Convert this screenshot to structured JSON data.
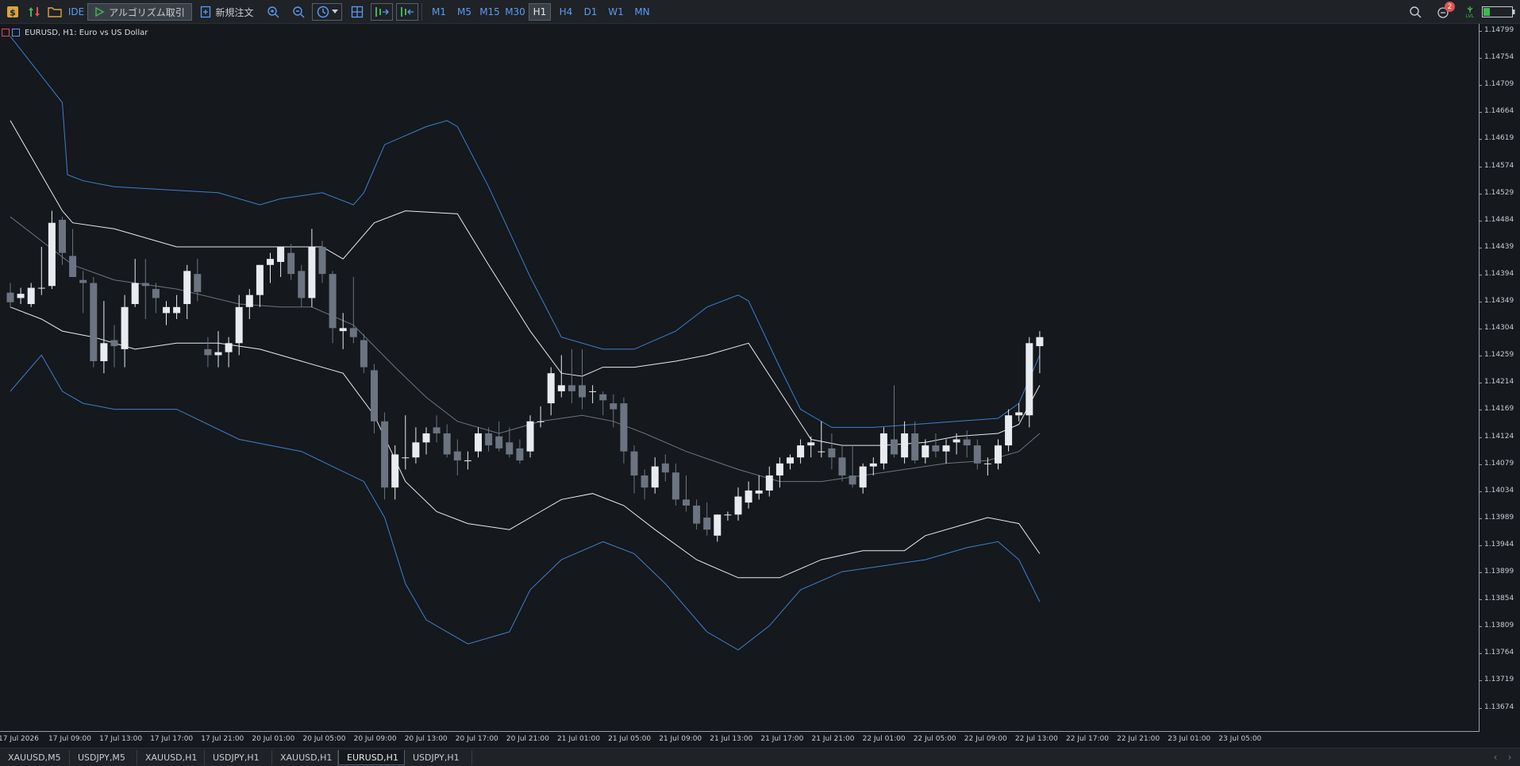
{
  "toolbar": {
    "ide_label": "IDE",
    "algo_label": "アルゴリズム取引",
    "new_order_label": "新規注文",
    "timeframes": [
      "M1",
      "M5",
      "M15",
      "M30",
      "H1",
      "H4",
      "D1",
      "W1",
      "MN"
    ],
    "active_timeframe": "H1",
    "notification_count": "2",
    "lvl_label": "LVL"
  },
  "chart": {
    "legend": "EURUSD, H1:  Euro vs US Dollar",
    "price_labels": [
      "1.14799",
      "1.14754",
      "1.14709",
      "1.14664",
      "1.14619",
      "1.14574",
      "1.14529",
      "1.14484",
      "1.14439",
      "1.14394",
      "1.14349",
      "1.14304",
      "1.14259",
      "1.14214",
      "1.14169",
      "1.14124",
      "1.14079",
      "1.14034",
      "1.13989",
      "1.13944",
      "1.13899",
      "1.13854",
      "1.13809",
      "1.13764",
      "1.13719",
      "1.13674"
    ],
    "time_labels": [
      "17 Jul 2026",
      "17 Jul 09:00",
      "17 Jul 13:00",
      "17 Jul 17:00",
      "17 Jul 21:00",
      "20 Jul 01:00",
      "20 Jul 05:00",
      "20 Jul 09:00",
      "20 Jul 13:00",
      "20 Jul 17:00",
      "20 Jul 21:00",
      "21 Jul 01:00",
      "21 Jul 05:00",
      "21 Jul 09:00",
      "21 Jul 13:00",
      "21 Jul 17:00",
      "21 Jul 21:00",
      "22 Jul 01:00",
      "22 Jul 05:00",
      "22 Jul 09:00",
      "22 Jul 13:00",
      "22 Jul 17:00",
      "22 Jul 21:00",
      "23 Jul 01:00",
      "23 Jul 05:00"
    ],
    "colors": {
      "bull": "#e8ebf0",
      "bear": "#6b7480",
      "outer_band": "#3d7fd0",
      "inner_band": "#e8ebf0",
      "mid_line": "#6e747c",
      "background": "#15181d"
    }
  },
  "tabs": [
    {
      "label": "XAUUSD,M5",
      "active": false
    },
    {
      "label": "USDJPY,M5",
      "active": false
    },
    {
      "label": "XAUUSD,H1",
      "active": false
    },
    {
      "label": "USDJPY,H1",
      "active": false
    },
    {
      "label": "XAUUSD,H1",
      "active": false
    },
    {
      "label": "EURUSD,H1",
      "active": true
    },
    {
      "label": "USDJPY,H1",
      "active": false
    }
  ],
  "chart_data": {
    "type": "candlestick",
    "symbol": "EURUSD",
    "timeframe": "H1",
    "ylim": [
      1.1365,
      1.148
    ],
    "y_range_labeled": [
      1.13674,
      1.14799
    ],
    "candles": [
      [
        1.14364,
        1.1438,
        1.1434,
        1.14348
      ],
      [
        1.14355,
        1.14372,
        1.14345,
        1.14362
      ],
      [
        1.14345,
        1.1438,
        1.1434,
        1.14372
      ],
      [
        1.14372,
        1.1444,
        1.1436,
        1.14372
      ],
      [
        1.14375,
        1.145,
        1.1437,
        1.1448
      ],
      [
        1.14485,
        1.1449,
        1.1441,
        1.1443
      ],
      [
        1.14425,
        1.1447,
        1.1439,
        1.1439
      ],
      [
        1.14385,
        1.144,
        1.1433,
        1.1438
      ],
      [
        1.1438,
        1.1439,
        1.1424,
        1.1425
      ],
      [
        1.1425,
        1.1435,
        1.1423,
        1.1428
      ],
      [
        1.14285,
        1.1431,
        1.1424,
        1.14275
      ],
      [
        1.1427,
        1.1436,
        1.1424,
        1.1434
      ],
      [
        1.14345,
        1.1442,
        1.1434,
        1.1438
      ],
      [
        1.1438,
        1.1442,
        1.1432,
        1.14375
      ],
      [
        1.1437,
        1.1438,
        1.1433,
        1.14355
      ],
      [
        1.1433,
        1.1435,
        1.1431,
        1.1434
      ],
      [
        1.1433,
        1.1436,
        1.1432,
        1.1434
      ],
      [
        1.14345,
        1.1441,
        1.1432,
        1.144
      ],
      [
        1.14395,
        1.1442,
        1.1435,
        1.14365
      ],
      [
        1.1427,
        1.1429,
        1.1424,
        1.1426
      ],
      [
        1.1426,
        1.143,
        1.1424,
        1.14265
      ],
      [
        1.14265,
        1.1429,
        1.1424,
        1.1428
      ],
      [
        1.1428,
        1.1436,
        1.1426,
        1.1434
      ],
      [
        1.1434,
        1.1437,
        1.1432,
        1.1436
      ],
      [
        1.1436,
        1.1441,
        1.1434,
        1.1441
      ],
      [
        1.1441,
        1.1443,
        1.1438,
        1.1442
      ],
      [
        1.14415,
        1.1444,
        1.1439,
        1.1444
      ],
      [
        1.1443,
        1.14445,
        1.14385,
        1.14395
      ],
      [
        1.144,
        1.1441,
        1.1434,
        1.14355
      ],
      [
        1.14355,
        1.1447,
        1.1434,
        1.1444
      ],
      [
        1.1444,
        1.1445,
        1.1438,
        1.14395
      ],
      [
        1.14395,
        1.144,
        1.1428,
        1.14305
      ],
      [
        1.143,
        1.1433,
        1.1427,
        1.14305
      ],
      [
        1.14305,
        1.1439,
        1.1428,
        1.1429
      ],
      [
        1.14285,
        1.14295,
        1.1423,
        1.1424
      ],
      [
        1.14235,
        1.14245,
        1.1413,
        1.1415
      ],
      [
        1.1415,
        1.14165,
        1.1402,
        1.1404
      ],
      [
        1.1404,
        1.1411,
        1.1402,
        1.14095
      ],
      [
        1.1409,
        1.1416,
        1.1407,
        1.1409
      ],
      [
        1.1409,
        1.1414,
        1.1408,
        1.14115
      ],
      [
        1.14115,
        1.1414,
        1.14095,
        1.1413
      ],
      [
        1.1414,
        1.1416,
        1.14115,
        1.1413
      ],
      [
        1.1413,
        1.14145,
        1.1409,
        1.14095
      ],
      [
        1.141,
        1.1412,
        1.1406,
        1.14085
      ],
      [
        1.14085,
        1.141,
        1.1407,
        1.14085
      ],
      [
        1.141,
        1.1414,
        1.1409,
        1.1413
      ],
      [
        1.1413,
        1.1414,
        1.141,
        1.1411
      ],
      [
        1.14125,
        1.1415,
        1.141,
        1.14105
      ],
      [
        1.14115,
        1.1414,
        1.1409,
        1.14095
      ],
      [
        1.14105,
        1.1412,
        1.1408,
        1.14085
      ],
      [
        1.141,
        1.1416,
        1.1409,
        1.1415
      ],
      [
        1.1415,
        1.14175,
        1.1414,
        1.1415
      ],
      [
        1.1418,
        1.1424,
        1.1416,
        1.1423
      ],
      [
        1.142,
        1.1426,
        1.1419,
        1.1421
      ],
      [
        1.1421,
        1.1427,
        1.1418,
        1.142
      ],
      [
        1.1421,
        1.1427,
        1.1417,
        1.1419
      ],
      [
        1.142,
        1.1421,
        1.1418,
        1.142
      ],
      [
        1.14195,
        1.142,
        1.1416,
        1.14185
      ],
      [
        1.1418,
        1.14195,
        1.1414,
        1.1417
      ],
      [
        1.1418,
        1.1419,
        1.1408,
        1.141
      ],
      [
        1.141,
        1.1411,
        1.1403,
        1.1406
      ],
      [
        1.1406,
        1.1407,
        1.1402,
        1.1404
      ],
      [
        1.1404,
        1.1409,
        1.1403,
        1.14075
      ],
      [
        1.1408,
        1.14095,
        1.1405,
        1.14065
      ],
      [
        1.14065,
        1.1408,
        1.1401,
        1.1402
      ],
      [
        1.1402,
        1.1406,
        1.14,
        1.1401
      ],
      [
        1.1401,
        1.1402,
        1.1397,
        1.1398
      ],
      [
        1.1399,
        1.14015,
        1.1396,
        1.1397
      ],
      [
        1.1396,
        1.13995,
        1.1395,
        1.13995
      ],
      [
        1.13995,
        1.14,
        1.13985,
        1.13995
      ],
      [
        1.13995,
        1.1404,
        1.13985,
        1.14025
      ],
      [
        1.14015,
        1.1405,
        1.14005,
        1.14035
      ],
      [
        1.1403,
        1.1406,
        1.1402,
        1.14035
      ],
      [
        1.14035,
        1.14075,
        1.14025,
        1.1406
      ],
      [
        1.1406,
        1.1409,
        1.1404,
        1.1408
      ],
      [
        1.1408,
        1.14095,
        1.1407,
        1.1409
      ],
      [
        1.1409,
        1.1412,
        1.1408,
        1.1411
      ],
      [
        1.1411,
        1.14125,
        1.1409,
        1.14115
      ],
      [
        1.141,
        1.1415,
        1.1409,
        1.141
      ],
      [
        1.14105,
        1.1413,
        1.1407,
        1.1409
      ],
      [
        1.1409,
        1.1411,
        1.1405,
        1.1406
      ],
      [
        1.1406,
        1.1411,
        1.1404,
        1.14045
      ],
      [
        1.1404,
        1.1408,
        1.1403,
        1.14075
      ],
      [
        1.14075,
        1.1409,
        1.1406,
        1.1408
      ],
      [
        1.1408,
        1.1414,
        1.1407,
        1.1413
      ],
      [
        1.1412,
        1.1421,
        1.1409,
        1.14095
      ],
      [
        1.1409,
        1.1415,
        1.1408,
        1.1413
      ],
      [
        1.1413,
        1.1415,
        1.1408,
        1.14085
      ],
      [
        1.1409,
        1.1412,
        1.1408,
        1.1411
      ],
      [
        1.1411,
        1.1413,
        1.1409,
        1.141
      ],
      [
        1.141,
        1.1412,
        1.1408,
        1.1411
      ],
      [
        1.14115,
        1.1413,
        1.14095,
        1.1412
      ],
      [
        1.1412,
        1.14135,
        1.1409,
        1.1411
      ],
      [
        1.1411,
        1.1412,
        1.1407,
        1.1408
      ],
      [
        1.1408,
        1.1409,
        1.1406,
        1.1408
      ],
      [
        1.1408,
        1.1412,
        1.1407,
        1.1411
      ],
      [
        1.1411,
        1.1417,
        1.141,
        1.1416
      ],
      [
        1.1416,
        1.1418,
        1.1415,
        1.14165
      ],
      [
        1.1416,
        1.1429,
        1.1414,
        1.1428
      ],
      [
        1.14275,
        1.143,
        1.1423,
        1.1429
      ]
    ],
    "bands": {
      "outer_upper": [
        [
          0,
          1.1479
        ],
        [
          5,
          1.1468
        ],
        [
          5.5,
          1.1456
        ],
        [
          7,
          1.1455
        ],
        [
          10,
          1.1454
        ],
        [
          20,
          1.1453
        ],
        [
          24,
          1.1451
        ],
        [
          26,
          1.1452
        ],
        [
          30,
          1.1453
        ],
        [
          33,
          1.1451
        ],
        [
          34,
          1.1453
        ],
        [
          35,
          1.1457
        ],
        [
          36,
          1.1461
        ],
        [
          40,
          1.1464
        ],
        [
          42,
          1.1465
        ],
        [
          43,
          1.1464
        ],
        [
          46,
          1.1454
        ],
        [
          50,
          1.1439
        ],
        [
          53,
          1.1429
        ],
        [
          57,
          1.1427
        ],
        [
          60,
          1.1427
        ],
        [
          64,
          1.143
        ],
        [
          67,
          1.1434
        ],
        [
          70,
          1.1436
        ],
        [
          71,
          1.1435
        ],
        [
          74,
          1.1424
        ],
        [
          76,
          1.1417
        ],
        [
          79,
          1.1414
        ],
        [
          83,
          1.1414
        ],
        [
          87,
          1.14145
        ],
        [
          91,
          1.1415
        ],
        [
          95,
          1.14155
        ],
        [
          97,
          1.1418
        ],
        [
          99,
          1.1426
        ]
      ],
      "inner_upper": [
        [
          0,
          1.1465
        ],
        [
          3,
          1.1456
        ],
        [
          5,
          1.145
        ],
        [
          6,
          1.1448
        ],
        [
          10,
          1.1447
        ],
        [
          16,
          1.1444
        ],
        [
          24,
          1.1444
        ],
        [
          30,
          1.1444
        ],
        [
          32,
          1.1442
        ],
        [
          35,
          1.1448
        ],
        [
          38,
          1.145
        ],
        [
          43,
          1.14495
        ],
        [
          46,
          1.1441
        ],
        [
          50,
          1.143
        ],
        [
          53,
          1.1423
        ],
        [
          55,
          1.14225
        ],
        [
          57,
          1.1424
        ],
        [
          60,
          1.1424
        ],
        [
          64,
          1.1425
        ],
        [
          67,
          1.1426
        ],
        [
          71,
          1.1428
        ],
        [
          74,
          1.142
        ],
        [
          77,
          1.1412
        ],
        [
          80,
          1.1411
        ],
        [
          84,
          1.1411
        ],
        [
          88,
          1.14115
        ],
        [
          91,
          1.14125
        ],
        [
          95,
          1.1413
        ],
        [
          97,
          1.14145
        ],
        [
          99,
          1.1421
        ]
      ],
      "middle": [
        [
          0,
          1.1449
        ],
        [
          3,
          1.1445
        ],
        [
          6,
          1.1441
        ],
        [
          10,
          1.14385
        ],
        [
          16,
          1.1437
        ],
        [
          22,
          1.14345
        ],
        [
          26,
          1.1434
        ],
        [
          29,
          1.1434
        ],
        [
          33,
          1.1431
        ],
        [
          37,
          1.1424
        ],
        [
          40,
          1.1419
        ],
        [
          43,
          1.1415
        ],
        [
          47,
          1.1413
        ],
        [
          51,
          1.1415
        ],
        [
          55,
          1.1416
        ],
        [
          58,
          1.1415
        ],
        [
          61,
          1.1413
        ],
        [
          65,
          1.141
        ],
        [
          70,
          1.1407
        ],
        [
          74,
          1.1405
        ],
        [
          78,
          1.1405
        ],
        [
          82,
          1.1406
        ],
        [
          86,
          1.1407
        ],
        [
          90,
          1.1408
        ],
        [
          94,
          1.14085
        ],
        [
          97,
          1.141
        ],
        [
          99,
          1.1413
        ]
      ],
      "inner_lower": [
        [
          0,
          1.1434
        ],
        [
          3,
          1.1432
        ],
        [
          5,
          1.143
        ],
        [
          8,
          1.1429
        ],
        [
          12,
          1.1427
        ],
        [
          16,
          1.1428
        ],
        [
          20,
          1.1428
        ],
        [
          24,
          1.1427
        ],
        [
          28,
          1.1425
        ],
        [
          32,
          1.1423
        ],
        [
          35,
          1.1416
        ],
        [
          38,
          1.1405
        ],
        [
          41,
          1.14
        ],
        [
          44,
          1.1398
        ],
        [
          48,
          1.1397
        ],
        [
          51,
          1.14
        ],
        [
          53,
          1.1402
        ],
        [
          56,
          1.1403
        ],
        [
          59,
          1.1401
        ],
        [
          62,
          1.1397
        ],
        [
          66,
          1.1392
        ],
        [
          70,
          1.1389
        ],
        [
          74,
          1.1389
        ],
        [
          78,
          1.1392
        ],
        [
          82,
          1.13935
        ],
        [
          86,
          1.13935
        ],
        [
          88,
          1.1396
        ],
        [
          92,
          1.1398
        ],
        [
          94,
          1.1399
        ],
        [
          97,
          1.1398
        ],
        [
          99,
          1.1393
        ]
      ],
      "outer_lower": [
        [
          0,
          1.142
        ],
        [
          3,
          1.1426
        ],
        [
          5,
          1.142
        ],
        [
          7,
          1.1418
        ],
        [
          10,
          1.1417
        ],
        [
          16,
          1.1417
        ],
        [
          22,
          1.1412
        ],
        [
          28,
          1.141
        ],
        [
          34,
          1.1405
        ],
        [
          36,
          1.1399
        ],
        [
          38,
          1.1388
        ],
        [
          40,
          1.1382
        ],
        [
          44,
          1.1378
        ],
        [
          48,
          1.138
        ],
        [
          50,
          1.1387
        ],
        [
          53,
          1.1392
        ],
        [
          57,
          1.1395
        ],
        [
          60,
          1.1393
        ],
        [
          63,
          1.1388
        ],
        [
          67,
          1.138
        ],
        [
          70,
          1.1377
        ],
        [
          73,
          1.1381
        ],
        [
          76,
          1.1387
        ],
        [
          80,
          1.139
        ],
        [
          84,
          1.1391
        ],
        [
          88,
          1.1392
        ],
        [
          92,
          1.1394
        ],
        [
          95,
          1.1395
        ],
        [
          97,
          1.1392
        ],
        [
          99,
          1.1385
        ]
      ]
    }
  }
}
